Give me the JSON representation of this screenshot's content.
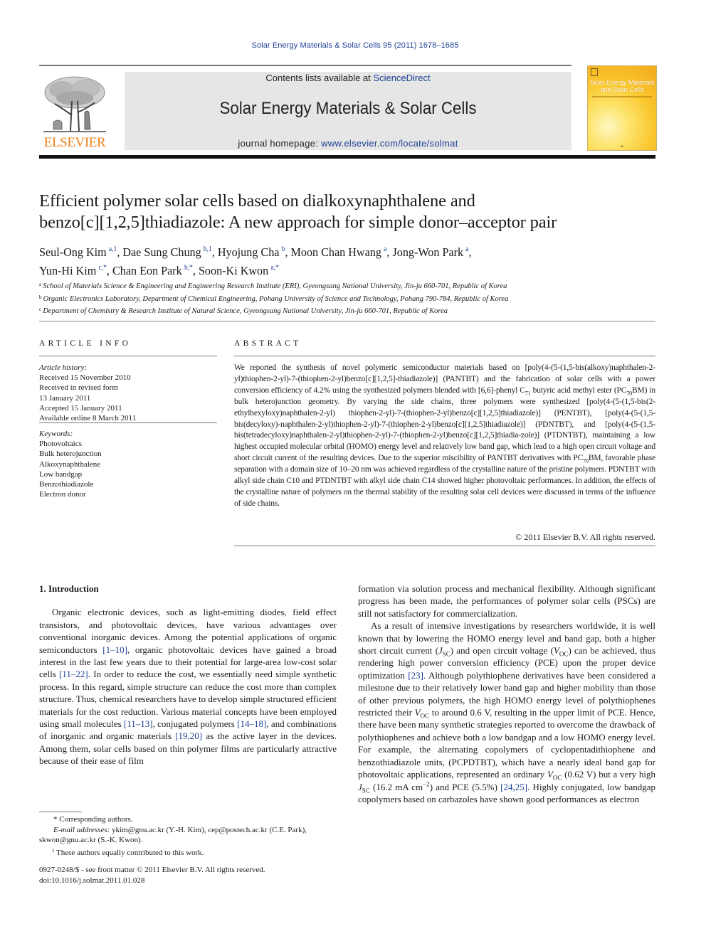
{
  "header": {
    "journal_reference": "Solar Energy Materials & Solar Cells 95 (2011) 1678–1685",
    "contents_prefix": "Contents lists available at ",
    "contents_link": "ScienceDirect",
    "journal_title": "Solar Energy Materials & Solar Cells",
    "homepage_prefix": "journal homepage: ",
    "homepage_link": "www.elsevier.com/locate/solmat",
    "publisher_logo_text": "ELSEVIER",
    "cover_title_line1": "Solar Energy Materials",
    "cover_title_line2": "and Solar Cells",
    "colors": {
      "link": "#1c3f94",
      "elsevier_orange": "#f07f1a",
      "banner_bg": "#e6e6e6"
    }
  },
  "article": {
    "title_line1": "Efficient polymer solar cells based on dialkoxynaphthalene and",
    "title_line2": "benzo[c][1,2,5]thiadiazole: A new approach for simple donor–acceptor pair",
    "authors": [
      {
        "name": "Seul-Ong Kim",
        "sup": "a,1",
        "sep": ", "
      },
      {
        "name": "Dae Sung Chung",
        "sup": "b,1",
        "sep": ", "
      },
      {
        "name": "Hyojung Cha",
        "sup": "b",
        "sep": ", "
      },
      {
        "name": "Moon Chan Hwang",
        "sup": "a",
        "sep": ", "
      },
      {
        "name": "Jong-Won Park",
        "sup": "a",
        "sep": ","
      },
      {
        "name": "Yun-Hi Kim",
        "sup": "c,*",
        "sep": ", "
      },
      {
        "name": "Chan Eon Park",
        "sup": "b,*",
        "sep": ", "
      },
      {
        "name": "Soon-Ki Kwon",
        "sup": "a,*",
        "sep": ""
      }
    ],
    "affiliations": [
      {
        "key": "a",
        "text": "School of Materials Science & Engineering and Engineering Research Institute (ERI), Gyeongsang National University, Jin-ju 660-701, Republic of Korea"
      },
      {
        "key": "b",
        "text": "Organic Electronics Laboratory, Department of Chemical Engineering, Pohang University of Science and Technology, Pohang 790-784, Republic of Korea"
      },
      {
        "key": "c",
        "text": "Department of Chemistry & Research Institute of Natural Science, Gyeongsang National University, Jin-ju 660-701, Republic of Korea"
      }
    ]
  },
  "article_info": {
    "heading": "ARTICLE INFO",
    "history_label": "Article history:",
    "history": [
      "Received 15 November 2010",
      "Received in revised form",
      "13 January 2011",
      "Accepted 15 January 2011",
      "Available online 8 March 2011"
    ],
    "keywords_label": "Keywords:",
    "keywords": [
      "Photovoltaics",
      "Bulk heterojunction",
      "Alkoxynaphthalene",
      "Low bandgap",
      "Benzothiadiazole",
      "Electron donor"
    ]
  },
  "abstract": {
    "heading": "ABSTRACT",
    "p1": "We reported the synthesis of novel polymeric semiconductor materials based on [poly(4-(5-(1,5-bis(alkoxy)naphthalen-2-yl)thiophen-2-yl)-7-(thiophen-2-yl)benzo[c][1,2,5]-thiadiazole)] (PANTBT) and the fabrication of solar cells with a power conversion efficiency of 4.2% using the synthesized polymers blended with [6,6]-phenyl C",
    "sub1": "71",
    "p2": " butyric acid methyl ester (PC",
    "sub2": "70",
    "p3": "BM) in bulk heterojunction geometry. By varying the side chains, three polymers were synthesized [poly(4-(5-(1,5-bis(2-ethylhexyloxy)naphthalen-2-yl) thiophen-2-yl)-7-(thiophen-2-yl)benzo[c][1,2,5]thiadiazole)] (PENTBT), [poly(4-(5-(1,5-bis(decyloxy)-naphthalen-2-yl)thiophen-2-yl)-7-(thiophen-2-yl)benzo[c][1,2,5]thiadiazole)] (PDNTBT), and [poly(4-(5-(1,5-bis(tetradecyloxy)naphthalen-2-yl)thiophen-2-yl)-7-(thiophen-2-yl)benzo[c][1,2,5]thiadia-zole)] (PTDNTBT), maintaining a low highest occupied molecular orbital (HOMO) energy level and relatively low band gap, which lead to a high open circuit voltage and short circuit current of the resulting devices. Due to the superior miscibility of PANTBT derivatives with PC",
    "sub3": "70",
    "p4": "BM, favorable phase separation with a domain size of 10–20 nm was achieved regardless of the crystalline nature of the pristine polymers. PDNTBT with alkyl side chain C10 and PTDNTBT with alkyl side chain C14 showed higher photovoltaic performances. In addition, the effects of the crystalline nature of polymers on the thermal stability of the resulting solar cell devices were discussed in terms of the influence of side chains.",
    "copyright": "© 2011 Elsevier B.V. All rights reserved."
  },
  "body": {
    "section_heading": "1.  Introduction",
    "left": {
      "t1": "Organic electronic devices, such as light-emitting diodes, field effect transistors, and photovoltaic devices, have various advantages over conventional inorganic devices. Among the potential applications of organic semiconductors ",
      "c1": "[1–10]",
      "t2": ", organic photovoltaic devices have gained a broad interest in the last few years due to their potential for large-area low-cost solar cells ",
      "c2": "[11–22]",
      "t3": ". In order to reduce the cost, we essentially need simple synthetic process. In this regard, simple structure can reduce the cost more than complex structure. Thus, chemical researchers have to develop simple structured efficient materials for the cost reduction. Various material concepts have been employed using small molecules ",
      "c3": "[11–13]",
      "t4": ", conjugated polymers ",
      "c4": "[14–18]",
      "t5": ", and combinations of inorganic and organic materials ",
      "c5": "[19,20]",
      "t6": " as the active layer in the devices. Among them, solar cells based on thin polymer films are particularly attractive because of their ease of film"
    },
    "right": {
      "p1": "formation via solution process and mechanical flexibility. Although significant progress has been made, the performances of polymer solar cells (PSCs) are still not satisfactory for commercialization.",
      "t1": "As a result of intensive investigations by researchers worldwide, it is well known that by lowering the HOMO energy level and band gap, both a higher short circuit current (",
      "jsc_J": "J",
      "jsc_sub": "SC",
      "t2": ") and open circuit voltage (",
      "voc_V": "V",
      "voc_sub": "OC",
      "t3": ") can be achieved, thus rendering high power conversion efficiency (PCE) upon the proper device optimization ",
      "c1": "[23]",
      "t4": ". Although polythiophene derivatives have been considered a milestone due to their relatively lower band gap and higher mobility than those of other previous polymers, the high HOMO energy level of polythiophenes restricted their ",
      "t5": " to around 0.6 V, resulting in the upper limit of PCE. Hence, there have been many synthetic strategies reported to overcome the drawback of polythiophenes and achieve both a low bandgap and a low HOMO energy level. For example, the alternating copolymers of cyclopentadithiophene and benzothiadiazole units, (PCPDTBT), which have a nearly ideal band gap for photovoltaic applications, represented an ordinary ",
      "t6": " (0.62 V) but a very high ",
      "t7": " (16.2 mA cm",
      "sup_neg2": "−2",
      "t8": ") and PCE (5.5%) ",
      "c2": "[24,25]",
      "t9": ". Highly conjugated, low bandgap copolymers based on carbazoles have shown good performances as electron"
    }
  },
  "footnotes": {
    "corresponding": "* Corresponding authors.",
    "email_label": "E-mail addresses:",
    "emails_line1": " ykim@gnu.ac.kr (Y.-H. Kim), cep@postech.ac.kr (C.E. Park),",
    "emails_line2": "skwon@gnu.ac.kr (S.-K. Kwon).",
    "equal_sup": "1",
    "equal_text": " These authors equally contributed to this work.",
    "front_matter": "0927-0248/$ - see front matter © 2011 Elsevier B.V. All rights reserved.",
    "doi": "doi:10.1016/j.solmat.2011.01.028"
  }
}
